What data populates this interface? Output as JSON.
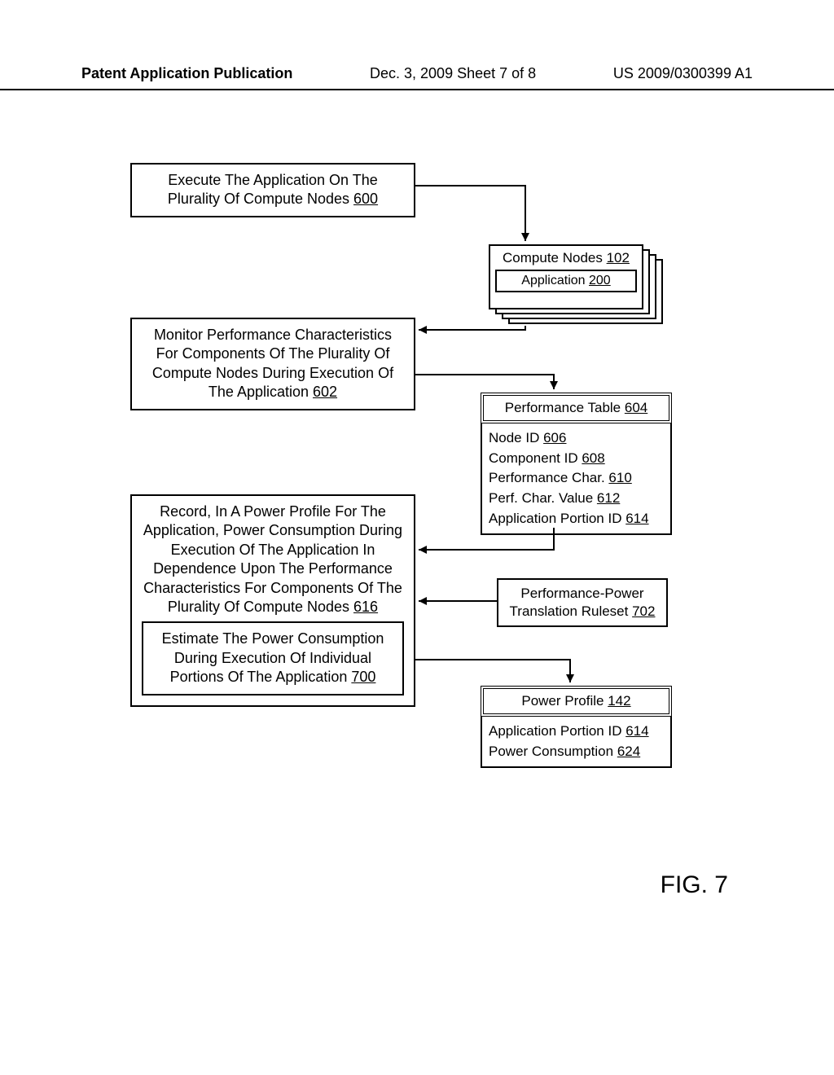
{
  "header": {
    "left": "Patent Application Publication",
    "mid": "Dec. 3, 2009  Sheet 7 of 8",
    "right": "US 2009/0300399 A1"
  },
  "step600": {
    "text": "Execute The Application On The Plurality Of Compute Nodes ",
    "ref": "600"
  },
  "compute": {
    "nodes_label": "Compute Nodes ",
    "nodes_ref": "102",
    "app_label": "Application ",
    "app_ref": "200"
  },
  "step602": {
    "text": "Monitor Performance Characteristics For Components Of The Plurality Of Compute Nodes During Execution Of The Application ",
    "ref": "602"
  },
  "perf_table": {
    "title": "Performance Table ",
    "title_ref": "604",
    "rows": [
      {
        "label": "Node ID ",
        "ref": "606"
      },
      {
        "label": "Component ID ",
        "ref": "608"
      },
      {
        "label": "Performance Char. ",
        "ref": "610"
      },
      {
        "label": "Perf. Char. Value ",
        "ref": "612"
      },
      {
        "label": "Application Portion ID ",
        "ref": "614"
      }
    ]
  },
  "step616": {
    "text": "Record, In A Power Profile For The Application, Power Consumption During Execution Of The Application In Dependence Upon The Performance Characteristics For Components Of The Plurality Of Compute Nodes ",
    "ref": "616"
  },
  "step700": {
    "text": "Estimate The Power Consumption During Execution Of Individual Portions Of The Application ",
    "ref": "700"
  },
  "ruleset": {
    "text": "Performance-Power Translation Ruleset ",
    "ref": "702"
  },
  "profile": {
    "title": "Power Profile ",
    "title_ref": "142",
    "rows": [
      {
        "label": "Application Portion ID ",
        "ref": "614"
      },
      {
        "label": "Power Consumption ",
        "ref": "624"
      }
    ]
  },
  "figure_label": "FIG. 7"
}
